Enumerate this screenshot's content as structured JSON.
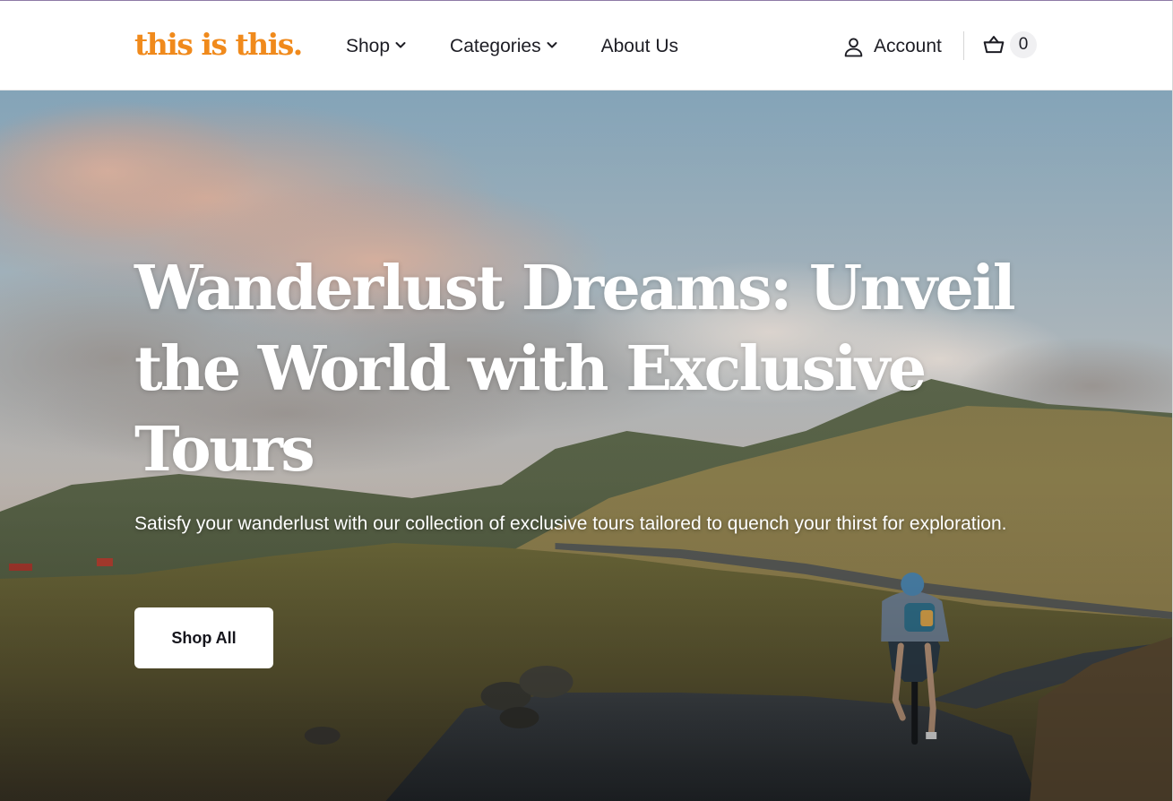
{
  "header": {
    "logo": "this is this.",
    "nav": [
      {
        "label": "Shop",
        "has_dropdown": true,
        "icon": "chevron-down-icon"
      },
      {
        "label": "Categories",
        "has_dropdown": true,
        "icon": "chevron-down-icon"
      },
      {
        "label": "About Us",
        "has_dropdown": false
      }
    ],
    "account_label": "Account",
    "account_icon": "user-icon",
    "cart_icon": "basket-icon",
    "cart_count": "0"
  },
  "hero": {
    "title": "Wanderlust Dreams: Unveil the World with Exclusive Tours",
    "subtitle": "Satisfy your wanderlust with our collection of exclusive tours tailored to quench your thirst for exploration.",
    "cta_label": "Shop All",
    "image": "landscape photo: cyclist riding a winding road through grassy hills at sunset"
  },
  "colors": {
    "brand": "#f08a1c",
    "text": "#1d1d24",
    "header_bg": "#ffffff",
    "cta_bg": "#ffffff",
    "cta_text": "#15151c"
  }
}
